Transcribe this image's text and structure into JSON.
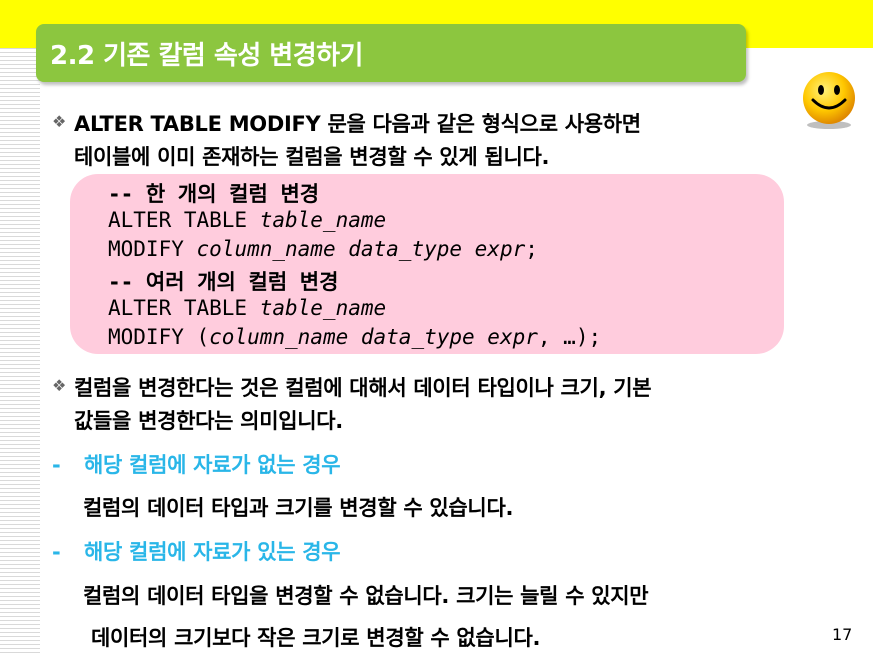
{
  "title": "2.2 기존 칼럼 속성 변경하기",
  "bullets": [
    {
      "lines": [
        "ALTER TABLE MODIFY 문을 다음과 같은 형식으로 사용하면",
        "테이블에 이미 존재하는 컬럼을 변경할 수 있게 됩니다."
      ]
    },
    {
      "lines": [
        "컬럼을 변경한다는 것은 컬럼에 대해서 데이터 타입이나 크기, 기본",
        "값들을 변경한다는 의미입니다."
      ]
    }
  ],
  "bullet_icon": "diamond-bullet-icon",
  "code": {
    "comment1": "-- 한 개의 컬럼 변경",
    "l2_kw": "ALTER TABLE ",
    "l2_it": "table_name",
    "l3_kw": "MODIFY ",
    "l3_it": "column_name data_type expr",
    "l3_end": ";",
    "comment2": "-- 여러 개의 컬럼 변경",
    "l5_kw": "ALTER TABLE ",
    "l5_it": "table_name",
    "l6_kw": "MODIFY (",
    "l6_it": "column_name data_type expr",
    "l6_end": ", …);"
  },
  "case1": {
    "dash": "-",
    "heading": "해당 컬럼에 자료가 없는 경우",
    "body": "컬럼의 데이터 타입과 크기를 변경할 수 있습니다."
  },
  "case2": {
    "dash": "-",
    "heading": "해당 컬럼에 자료가 있는 경우",
    "body1": "컬럼의 데이터 타입을 변경할 수 없습니다. 크기는 늘릴 수 있지만",
    "body2": "데이터의 크기보다 작은 크기로 변경할 수 없습니다."
  },
  "page_number": "17",
  "colors": {
    "title_bg": "#8cc63f",
    "top_band": "#ffff00",
    "code_bg": "#ffccdd",
    "heading_blue": "#29b6e8"
  },
  "decoration_icon": "smiley-face-icon"
}
